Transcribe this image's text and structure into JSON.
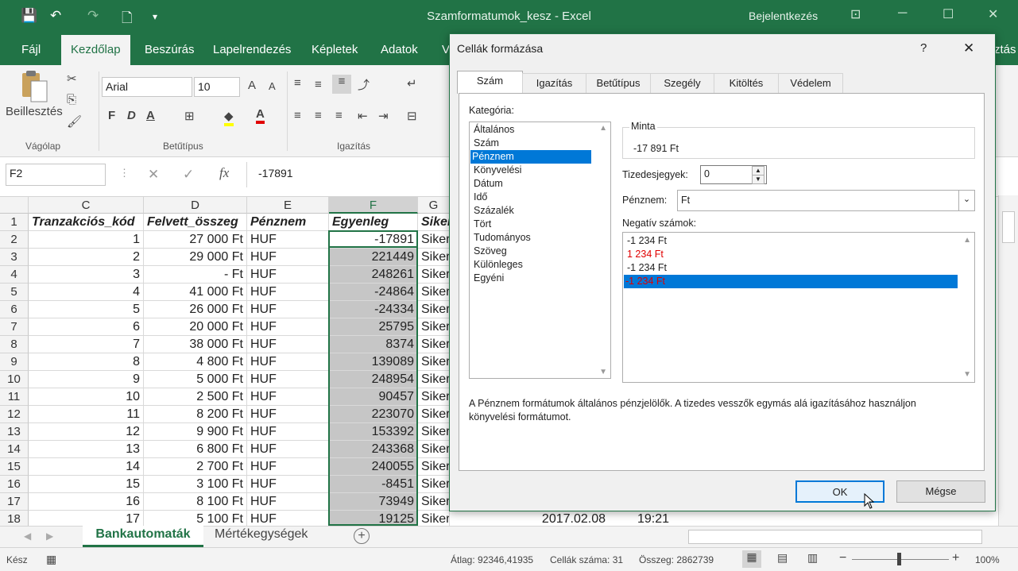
{
  "window": {
    "title": "Szamformatumok_kesz  -  Excel",
    "login": "Bejelentkezés",
    "minimize": "─",
    "restore": "☐",
    "close": "✕",
    "ribbon_options": "⊡"
  },
  "quick_access": {
    "save": "💾",
    "undo": "↶",
    "redo": "↷",
    "new": "🗋",
    "more": "▾"
  },
  "tabs": [
    "Fájl",
    "Kezdőlap",
    "Beszúrás",
    "Lapelrendezés",
    "Képletek",
    "Adatok",
    "V"
  ],
  "tabs_cut_right": "ztás",
  "ribbon": {
    "paste_label": "Beillesztés",
    "groups": {
      "clipboard": "Vágólap",
      "font": "Betűtípus",
      "alignment": "Igazítás"
    },
    "font_name": "Arial",
    "font_size": "10",
    "bold": "F",
    "italic": "D",
    "underline": "A",
    "grow_font": "A",
    "shrink_font": "A",
    "font_color": "A"
  },
  "formula_bar": {
    "name_box": "F2",
    "fx": "fx",
    "cancel": "✕",
    "enter": "✓",
    "value": "-17891"
  },
  "columns": [
    "C",
    "D",
    "E",
    "F",
    "G"
  ],
  "header_row": {
    "num": "1",
    "c": "Tranzakciós_kód",
    "d": "Felvett_összeg",
    "e": "Pénznem",
    "f": "Egyenleg",
    "g": "Siker"
  },
  "rows": [
    {
      "num": "2",
      "c": "1",
      "d": "27 000 Ft",
      "e": "HUF",
      "f": "-17891",
      "g": "Siker"
    },
    {
      "num": "3",
      "c": "2",
      "d": "29 000 Ft",
      "e": "HUF",
      "f": "221449",
      "g": "Siker"
    },
    {
      "num": "4",
      "c": "3",
      "d": "-    Ft",
      "e": "HUF",
      "f": "248261",
      "g": "Siker"
    },
    {
      "num": "5",
      "c": "4",
      "d": "41 000 Ft",
      "e": "HUF",
      "f": "-24864",
      "g": "Siker"
    },
    {
      "num": "6",
      "c": "5",
      "d": "26 000 Ft",
      "e": "HUF",
      "f": "-24334",
      "g": "Siker"
    },
    {
      "num": "7",
      "c": "6",
      "d": "20 000 Ft",
      "e": "HUF",
      "f": "25795",
      "g": "Siker"
    },
    {
      "num": "8",
      "c": "7",
      "d": "38 000 Ft",
      "e": "HUF",
      "f": "8374",
      "g": "Siker"
    },
    {
      "num": "9",
      "c": "8",
      "d": "4 800 Ft",
      "e": "HUF",
      "f": "139089",
      "g": "Siker"
    },
    {
      "num": "10",
      "c": "9",
      "d": "5 000 Ft",
      "e": "HUF",
      "f": "248954",
      "g": "Siker"
    },
    {
      "num": "11",
      "c": "10",
      "d": "2 500 Ft",
      "e": "HUF",
      "f": "90457",
      "g": "Siker"
    },
    {
      "num": "12",
      "c": "11",
      "d": "8 200 Ft",
      "e": "HUF",
      "f": "223070",
      "g": "Siker"
    },
    {
      "num": "13",
      "c": "12",
      "d": "9 900 Ft",
      "e": "HUF",
      "f": "153392",
      "g": "Siker"
    },
    {
      "num": "14",
      "c": "13",
      "d": "6 800 Ft",
      "e": "HUF",
      "f": "243368",
      "g": "Siker"
    },
    {
      "num": "15",
      "c": "14",
      "d": "2 700 Ft",
      "e": "HUF",
      "f": "240055",
      "g": "Siker"
    },
    {
      "num": "16",
      "c": "15",
      "d": "3 100 Ft",
      "e": "HUF",
      "f": "-8451",
      "g": "Siker"
    },
    {
      "num": "17",
      "c": "16",
      "d": "8 100 Ft",
      "e": "HUF",
      "f": "73949",
      "g": "Siker"
    },
    {
      "num": "18",
      "c": "17",
      "d": "5 100 Ft",
      "e": "HUF",
      "f": "19125",
      "g": "Sikeres"
    }
  ],
  "row18_extra": {
    "date": "2017.02.08",
    "time": "19:21"
  },
  "sheets": {
    "active": "Bankautomaták",
    "other": "Mértékegységek",
    "add": "+"
  },
  "status_bar": {
    "ready": "Kész",
    "average": "Átlag: 92346,41935",
    "count": "Cellák száma: 31",
    "sum": "Összeg: 2862739",
    "zoom": "100%",
    "minus": "−",
    "plus": "+"
  },
  "dialog": {
    "title": "Cellák formázása",
    "help": "?",
    "close": "✕",
    "tabs": [
      "Szám",
      "Igazítás",
      "Betűtípus",
      "Szegély",
      "Kitöltés",
      "Védelem"
    ],
    "category_label": "Kategória:",
    "categories": [
      "Általános",
      "Szám",
      "Pénznem",
      "Könyvelési",
      "Dátum",
      "Idő",
      "Százalék",
      "Tört",
      "Tudományos",
      "Szöveg",
      "Különleges",
      "Egyéni"
    ],
    "selected_category": "Pénznem",
    "sample_label": "Minta",
    "sample_value": "-17 891 Ft",
    "decimals_label": "Tizedesjegyek:",
    "decimals_value": "0",
    "currency_label": "Pénznem:",
    "currency_value": "Ft",
    "negative_label": "Negatív számok:",
    "negative_options": [
      "-1 234 Ft",
      "1 234 Ft",
      "-1 234 Ft",
      "-1 234 Ft"
    ],
    "description": "A Pénznem formátumok általános pénzjelölők. A tizedes vesszők egymás alá igazításához használjon könyvelési formátumot.",
    "ok": "OK",
    "cancel": "Mégse",
    "red_color": "#e00000",
    "highlight_color": "#0078d7"
  }
}
